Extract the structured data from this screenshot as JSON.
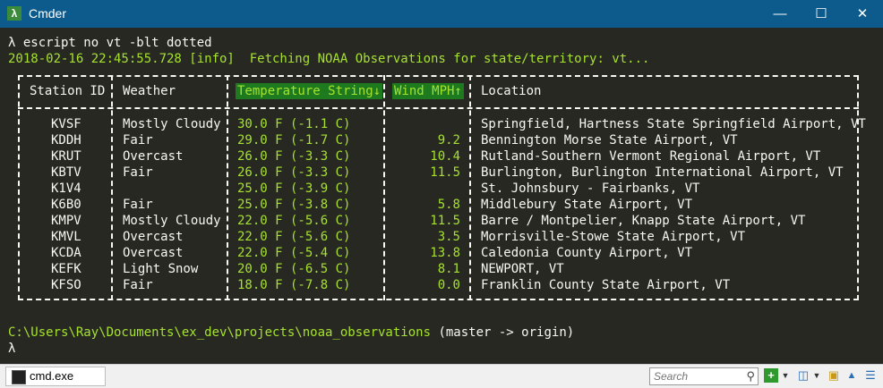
{
  "window": {
    "title": "Cmder",
    "app_icon": "λ"
  },
  "terminal": {
    "command_line": "λ escript no vt -blt dotted",
    "info_line": "2018-02-16 22:45:55.728 [info]  Fetching NOAA Observations for state/territory: vt...",
    "cwd": "C:\\Users\\Ray\\Documents\\ex_dev\\projects\\noaa_observations",
    "branch": "(master -> origin)",
    "prompt": "λ"
  },
  "table": {
    "headers": [
      "Station ID",
      "Weather",
      "Temperature String↓",
      "Wind MPH↑",
      "Location"
    ],
    "rows": [
      [
        "KVSF",
        "Mostly Cloudy",
        "30.0 F (-1.1 C)",
        "",
        "Springfield, Hartness State Springfield Airport, VT"
      ],
      [
        "KDDH",
        "Fair",
        "29.0 F (-1.7 C)",
        "9.2",
        "Bennington Morse State Airport, VT"
      ],
      [
        "KRUT",
        "Overcast",
        "26.0 F (-3.3 C)",
        "10.4",
        "Rutland-Southern Vermont Regional Airport, VT"
      ],
      [
        "KBTV",
        "Fair",
        "26.0 F (-3.3 C)",
        "11.5",
        "Burlington, Burlington International Airport, VT"
      ],
      [
        "K1V4",
        "",
        "25.0 F (-3.9 C)",
        "",
        "St. Johnsbury - Fairbanks, VT"
      ],
      [
        "K6B0",
        "Fair",
        "25.0 F (-3.8 C)",
        "5.8",
        "Middlebury State Airport, VT"
      ],
      [
        "KMPV",
        "Mostly Cloudy",
        "22.0 F (-5.6 C)",
        "11.5",
        "Barre / Montpelier, Knapp State Airport, VT"
      ],
      [
        "KMVL",
        "Overcast",
        "22.0 F (-5.6 C)",
        "3.5",
        "Morrisville-Stowe State Airport, VT"
      ],
      [
        "KCDA",
        "Overcast",
        "22.0 F (-5.4 C)",
        "13.8",
        "Caledonia County Airport, VT"
      ],
      [
        "KEFK",
        "Light Snow",
        "20.0 F (-6.5 C)",
        "8.1",
        "NEWPORT, VT"
      ],
      [
        "KFSO",
        "Fair",
        "18.0 F (-7.8 C)",
        "0.0",
        "Franklin County State Airport, VT"
      ]
    ]
  },
  "statusbar": {
    "tab_label": "cmd.exe",
    "search_placeholder": "Search"
  },
  "colors": {
    "titlebar": "#0c5b8c",
    "terminal_bg": "#272822",
    "accent_green": "#a6e22e",
    "header_highlight": "#1e7a1e"
  }
}
